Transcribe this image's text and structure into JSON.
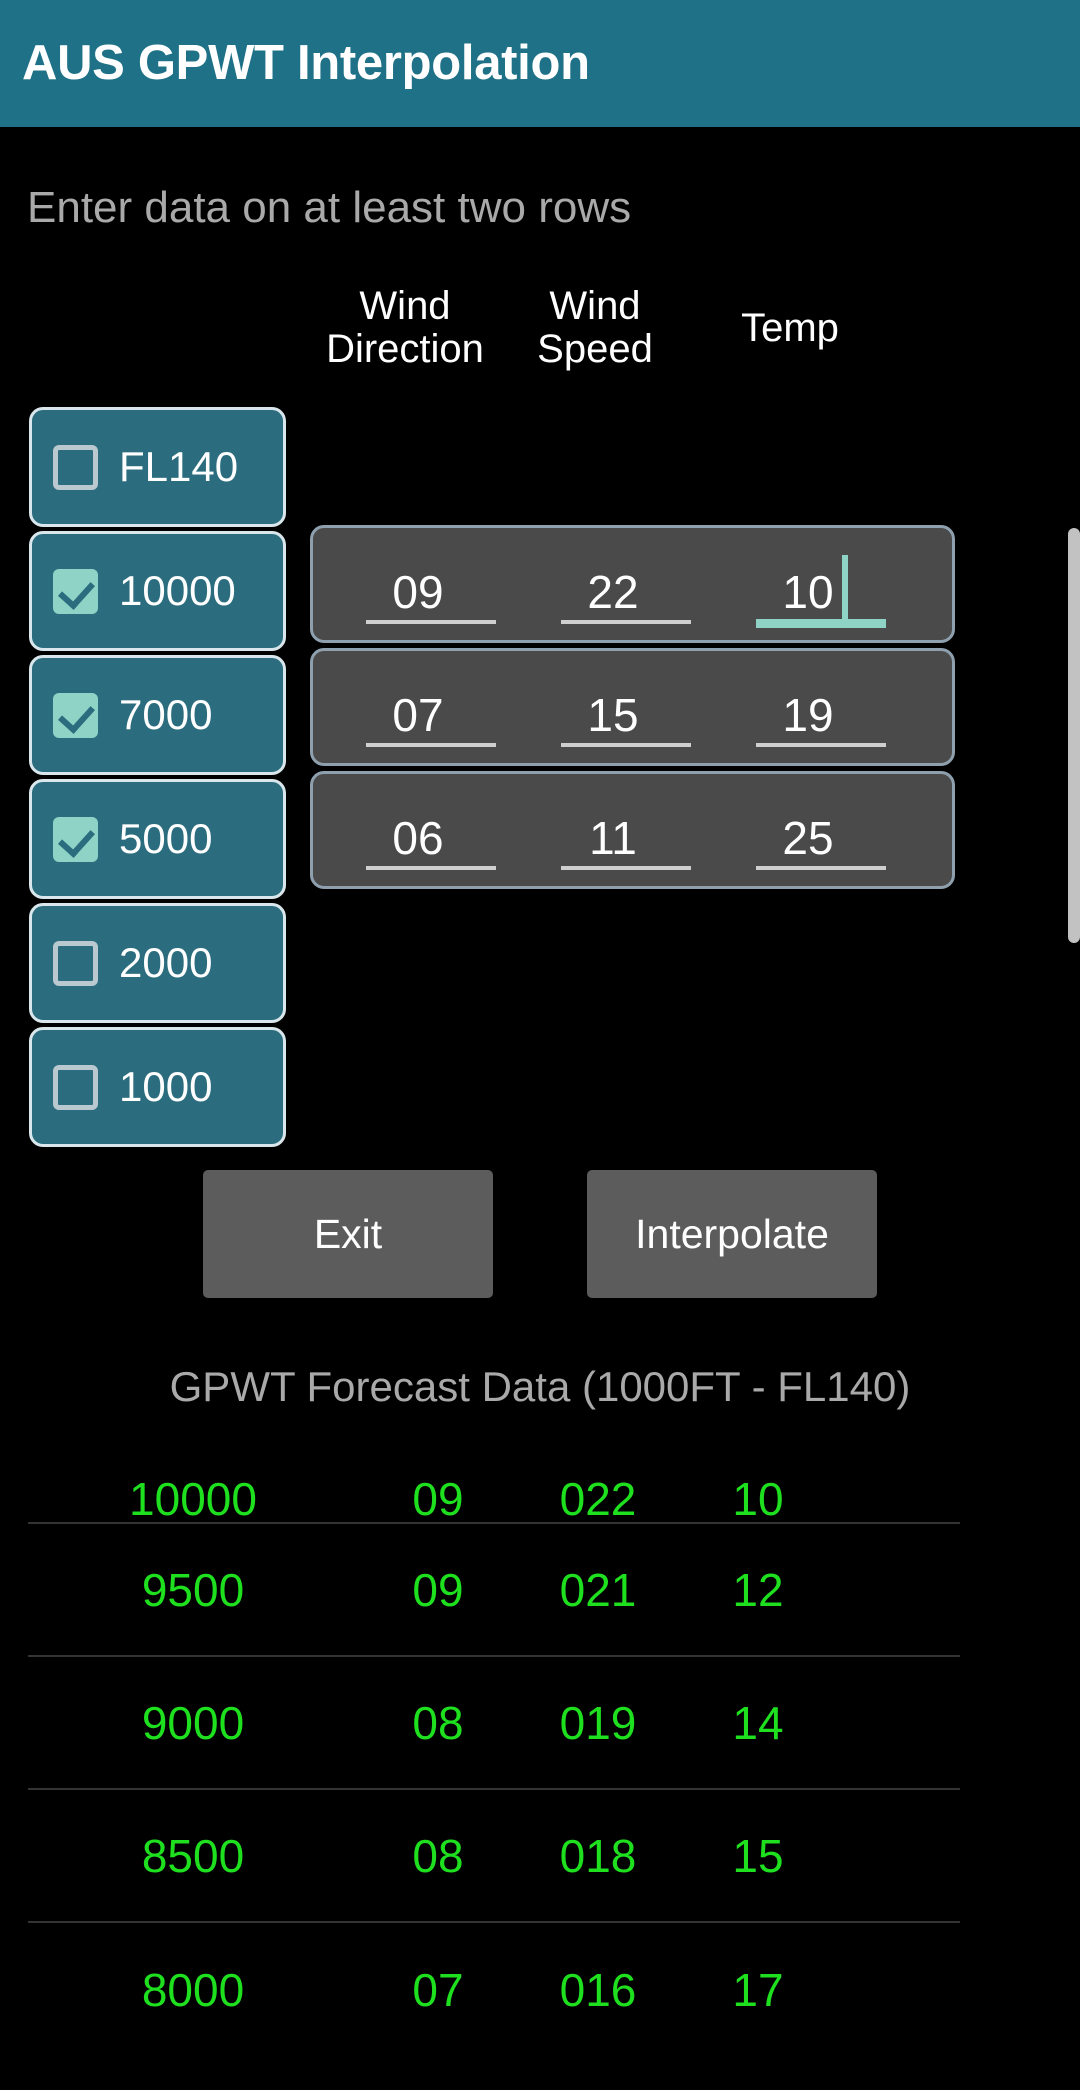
{
  "app": {
    "title": "AUS GPWT Interpolation",
    "accent_color": "#1e7186",
    "background_color": "#000000"
  },
  "instruction": "Enter data on at least two rows",
  "column_headers": {
    "wind_direction": "Wind\nDirection",
    "wind_direction_line1": "Wind",
    "wind_direction_line2": "Direction",
    "wind_speed_line1": "Wind",
    "wind_speed_line2": "Speed",
    "temp": "Temp"
  },
  "altitudes": [
    {
      "label": "FL140",
      "checked": false
    },
    {
      "label": "10000",
      "checked": true
    },
    {
      "label": "7000",
      "checked": true
    },
    {
      "label": "5000",
      "checked": true
    },
    {
      "label": "2000",
      "checked": false
    },
    {
      "label": "1000",
      "checked": false
    }
  ],
  "input_rows": [
    {
      "altitude": "10000",
      "wind_direction": "09",
      "wind_speed": "22",
      "temp": "10",
      "focused_field": "temp"
    },
    {
      "altitude": "7000",
      "wind_direction": "07",
      "wind_speed": "15",
      "temp": "19",
      "focused_field": ""
    },
    {
      "altitude": "5000",
      "wind_direction": "06",
      "wind_speed": "11",
      "temp": "25",
      "focused_field": ""
    }
  ],
  "buttons": {
    "exit": "Exit",
    "interpolate": "Interpolate"
  },
  "forecast": {
    "title": "GPWT Forecast Data (1000FT - FL140)",
    "text_color": "#1ee01e",
    "rows": [
      {
        "altitude": "10000",
        "direction": "09",
        "speed": "022",
        "temp": "10"
      },
      {
        "altitude": "9500",
        "direction": "09",
        "speed": "021",
        "temp": "12"
      },
      {
        "altitude": "9000",
        "direction": "08",
        "speed": "019",
        "temp": "14"
      },
      {
        "altitude": "8500",
        "direction": "08",
        "speed": "018",
        "temp": "15"
      },
      {
        "altitude": "8000",
        "direction": "07",
        "speed": "016",
        "temp": "17"
      }
    ]
  },
  "scrollbar": {
    "color": "#c2c2c2"
  }
}
